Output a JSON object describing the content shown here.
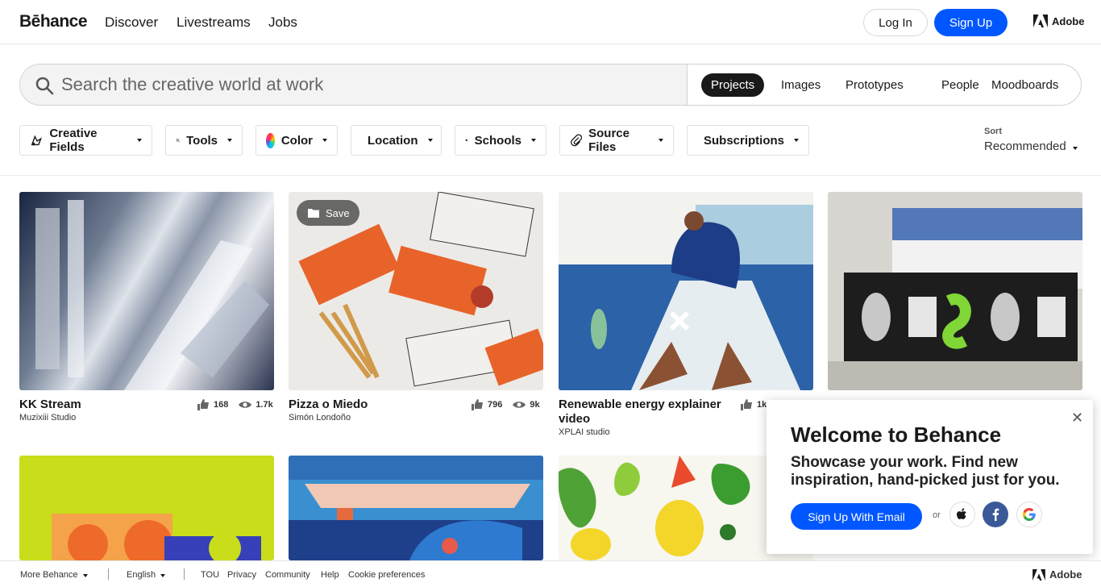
{
  "nav": {
    "logo": "Bēhance",
    "links": [
      "Discover",
      "Livestreams",
      "Jobs"
    ],
    "login": "Log In",
    "signup": "Sign Up",
    "adobe": "Adobe"
  },
  "search": {
    "placeholder": "Search the creative world at work",
    "tabs": [
      "Projects",
      "Images",
      "Prototypes",
      "People",
      "Moodboards"
    ],
    "active_tab": "Projects"
  },
  "filters": [
    "Creative Fields",
    "Tools",
    "Color",
    "Location",
    "Schools",
    "Source Files",
    "Subscriptions"
  ],
  "sort": {
    "label": "Sort",
    "value": "Recommended"
  },
  "projects": [
    {
      "title": "KK Stream",
      "owner": "Muzixiii Studio",
      "likes": "168",
      "views": "1.7k"
    },
    {
      "title": "Pizza o Miedo",
      "owner": "Simón Londoño",
      "likes": "796",
      "views": "9k",
      "save_label": "Save"
    },
    {
      "title": "Renewable energy explainer video",
      "owner": "XPLAI studio",
      "likes": "1k"
    }
  ],
  "popup": {
    "title": "Welcome to Behance",
    "text": "Showcase your work. Find new inspiration, hand-picked just for you.",
    "signup_email": "Sign Up With Email",
    "or": "or",
    "close": "✕"
  },
  "footer": {
    "more": "More Behance",
    "language": "English",
    "links": [
      "TOU",
      "Privacy",
      "Community",
      "Help",
      "Cookie preferences"
    ],
    "adobe": "Adobe"
  },
  "colors": {
    "accent": "#0057ff",
    "facebook": "#3b5998"
  }
}
